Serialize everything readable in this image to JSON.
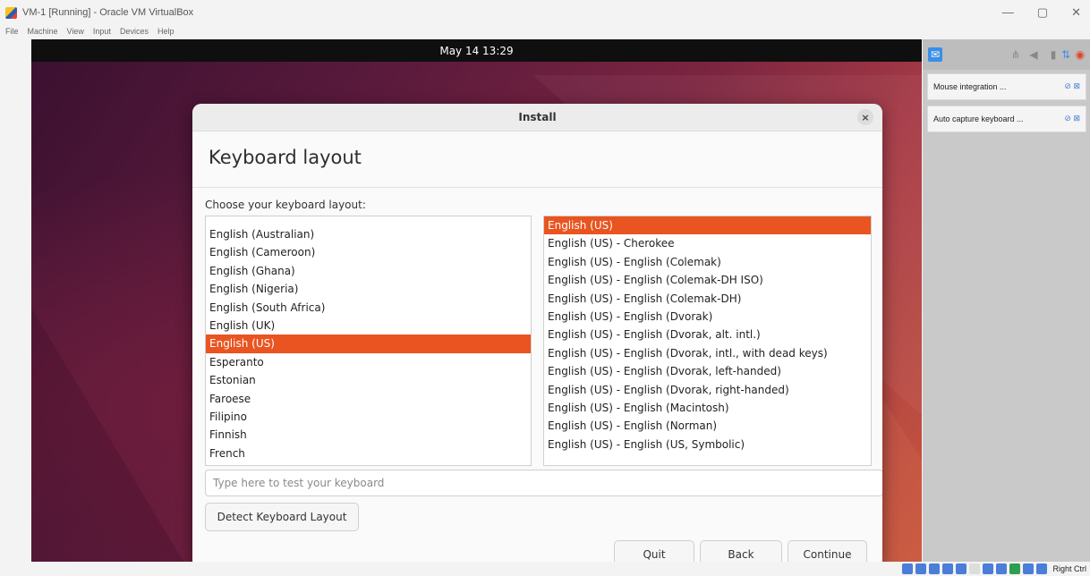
{
  "window": {
    "title": "VM-1 [Running] - Oracle VM VirtualBox",
    "controls": [
      "—",
      "▢",
      "✕"
    ]
  },
  "menu": [
    "File",
    "Machine",
    "View",
    "Input",
    "Devices",
    "Help"
  ],
  "guest": {
    "clock": "May 14  13:29"
  },
  "dialog": {
    "title": "Install",
    "close": "×",
    "heading": "Keyboard layout",
    "choose_label": "Choose your keyboard layout:",
    "left_list": {
      "items": [
        "English (Australian)",
        "English (Cameroon)",
        "English (Ghana)",
        "English (Nigeria)",
        "English (South Africa)",
        "English (UK)",
        "English (US)",
        "Esperanto",
        "Estonian",
        "Faroese",
        "Filipino",
        "Finnish",
        "French"
      ],
      "selected": "English (US)"
    },
    "right_list": {
      "items": [
        "English (US)",
        "English (US) - Cherokee",
        "English (US) - English (Colemak)",
        "English (US) - English (Colemak-DH ISO)",
        "English (US) - English (Colemak-DH)",
        "English (US) - English (Dvorak)",
        "English (US) - English (Dvorak, alt. intl.)",
        "English (US) - English (Dvorak, intl., with dead keys)",
        "English (US) - English (Dvorak, left-handed)",
        "English (US) - English (Dvorak, right-handed)",
        "English (US) - English (Macintosh)",
        "English (US) - English (Norman)",
        "English (US) - English (US, Symbolic)"
      ],
      "selected": "English (US)"
    },
    "test_placeholder": "Type here to test your keyboard",
    "detect_label": "Detect Keyboard Layout",
    "quit_label": "Quit",
    "back_label": "Back",
    "continue_label": "Continue"
  },
  "vbox_panel": {
    "notices": [
      "Mouse integration ...",
      "Auto capture keyboard ..."
    ]
  },
  "statusbar": {
    "host_key": "Right Ctrl"
  },
  "colors": {
    "accent": "#e95420",
    "topbar": "#0f0f0f"
  }
}
